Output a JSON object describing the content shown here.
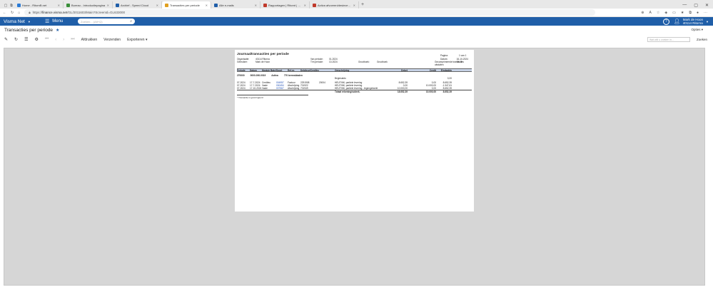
{
  "browser": {
    "tabs": [
      {
        "label": "Home - RitornB.net",
        "color": "#2b7bd6",
        "active": false
      },
      {
        "label": "Bureau - Introductiepagina",
        "color": "#3a8f3a",
        "active": false
      },
      {
        "label": "Archief - Speed Cloud",
        "color": "#1f5ea8",
        "active": false
      },
      {
        "label": "Transacties per periode",
        "color": "#e0a020",
        "active": true
      },
      {
        "label": "Alle e-mails",
        "color": "#1f5ea8",
        "active": false
      },
      {
        "label": "Rapportagen | Ritornt | Visma.net",
        "color": "#c0392b",
        "active": false
      },
      {
        "label": "Activa afvoeren/desinvesteren - ",
        "color": "#c0392b",
        "active": false
      }
    ],
    "url_prefix": "https://",
    "url_host": "finance.visma.net",
    "url_path": "/GL/2011603/Main?ScreenId=GL633000"
  },
  "app": {
    "brand": "Visma Net",
    "menu_label": "Menu",
    "search_placeholder": "Zoeken... (Alt+Q)",
    "user_name": "Mark de Hoon",
    "user_company": "40114 Ritorna"
  },
  "page": {
    "title": "Transacties per periode",
    "options": "Opties"
  },
  "toolbar": {
    "print": "Afdrukken",
    "send": "Verzenden",
    "export": "Exporteren",
    "find_placeholder": "Wat wilt u zoeken in...",
    "find_button": "Zoeken"
  },
  "report": {
    "title": "Journaaltransacties per periode",
    "org_label": "Organisatie:",
    "org_value": "40114 Ritorna",
    "user_label": "Gebruiker:",
    "user_value": "Mark de Hoon",
    "from_period_label": "Van periode:",
    "from_period_value": "01-2024",
    "to_period_label": "T/m periode:",
    "to_period_value": "10-2024",
    "ledger_label": "Grootboek:",
    "ledger_value": "Grootboek",
    "page_label": "Pagina:",
    "page_value": "1 van 1",
    "date_label": "Datum:",
    "date_value": "16-10-2024 09:15",
    "consolidated": "Gecomprimeerde transacties uitsluiten",
    "columns": [
      "Periode",
      "Datum",
      "Module Batch",
      "Soort",
      "Ref.nr.",
      "Debiteur/Crediteur",
      "",
      "Omschrijving",
      "Debet",
      "Credit",
      "Eindsaldo"
    ],
    "group": {
      "account": "270000",
      "sub": "0000-000-0019",
      "type": "Activa",
      "desc": "770 bermsbladen"
    },
    "opening_label": "Beginsaldo",
    "opening_value": "0,00",
    "rows": [
      {
        "period": "07-2024",
        "date": "17-7-2024",
        "module": "Crediteu",
        "batch": "004957",
        "type": "Factuur",
        "ref": "2291908",
        "party": "20004",
        "desc": "HEUTINK; partiele levering",
        "debit": "8.652,39",
        "credit": "0,00",
        "balance": "8.652,39"
      },
      {
        "period": "07-2024",
        "date": "17-7-2024",
        "module": "Vaste",
        "batch": "000454",
        "type": "Afschrijving",
        "ref": "701922",
        "party": "",
        "desc": "HEUTINK; partiele levering",
        "debit": "0,00",
        "credit": "10.000,00",
        "balance": "-1.347,61"
      },
      {
        "period": "07-2024",
        "date": "17-10-2024",
        "module": "Vaste",
        "batch": "007567",
        "type": "Afschrijving",
        "ref": "701949",
        "party": "",
        "desc": "HEUTINK; partiele levering - tegengeboekt",
        "debit": "10.000,00",
        "credit": "0,00",
        "balance": "8.652,39"
      }
    ],
    "total_label": "Totaal rekening/subrek.",
    "total_debit": "18.652,39",
    "total_credit": "10.000,00",
    "total_balance": "8.652,39",
    "footnote": "* Transactie is gecorrigeerd"
  }
}
